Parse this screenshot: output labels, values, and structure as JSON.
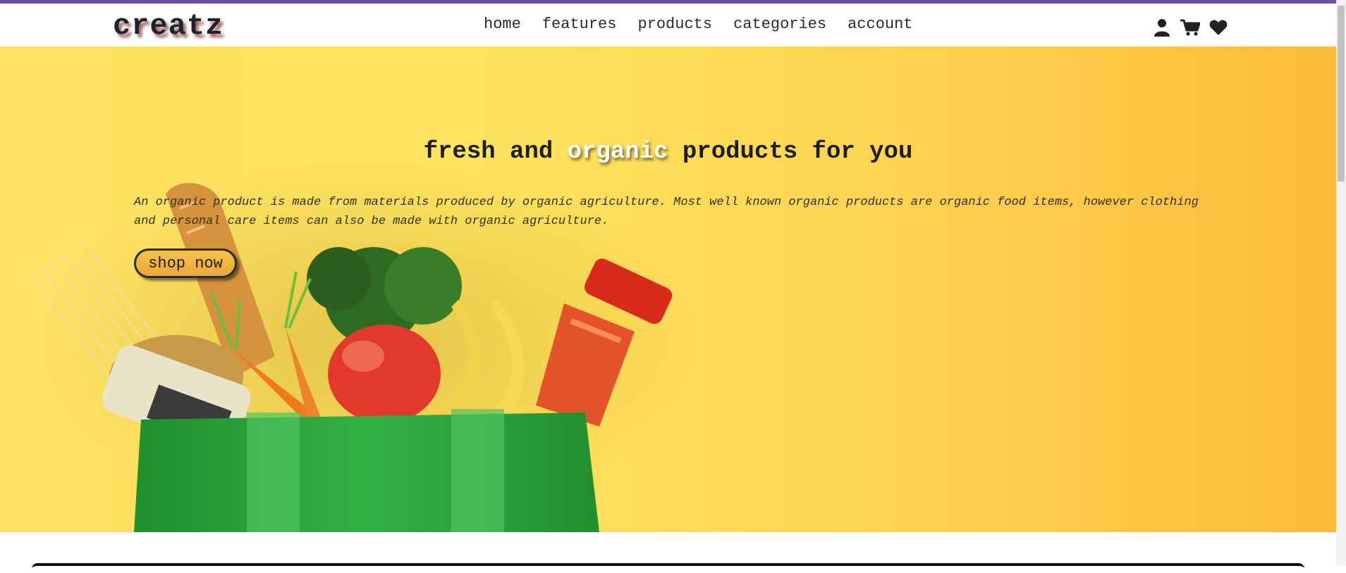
{
  "header": {
    "logo": "creatz",
    "nav": [
      "home",
      "features",
      "products",
      "categories",
      "account"
    ],
    "icons": [
      "user-icon",
      "cart-icon",
      "heart-icon"
    ]
  },
  "hero": {
    "title_part1": "fresh and",
    "title_highlight": "organic",
    "title_part2": "products for you",
    "description": "An organic product is made from materials produced by organic agriculture. Most well known organic products are organic food items, however clothing and personal care items can also be made with organic agriculture.",
    "button_label": "shop now"
  },
  "colors": {
    "accent_bar": "#6f4fa4",
    "hero_start": "#fde264",
    "hero_end": "#fdbb3a",
    "bag_green": "#2aa63a"
  }
}
